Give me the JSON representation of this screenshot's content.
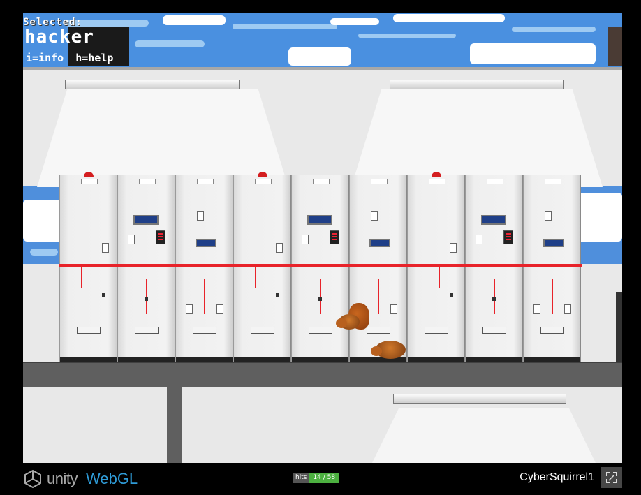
{
  "hud": {
    "selected_label": "Selected:",
    "selected_name": "hacker",
    "info_hint": "i=info",
    "help_hint": "h=help"
  },
  "footer": {
    "engine_brand": "unity",
    "platform_label": "WebGL",
    "hits_label": "hits",
    "hits_count": "14 / 58",
    "game_title": "CyberSquirrel1"
  },
  "icons": {
    "engine_logo": "unity-logo-icon",
    "fullscreen": "fullscreen-icon"
  },
  "colors": {
    "sky": "#4a90e0",
    "bus_bar": "#e8232a",
    "hits_badge": "#4cb040",
    "webgl_text": "#2f9bd7"
  },
  "scene": {
    "cabinet_count": 9,
    "squirrels": 2
  }
}
